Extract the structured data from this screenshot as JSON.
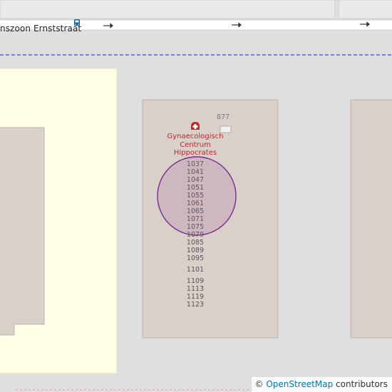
{
  "map": {
    "street_name": "nszoon Ernststraat",
    "poi": {
      "name_lines": [
        "Gynaecologisch",
        "Centrum",
        "Hippocrates"
      ],
      "icon": "medical-cross-icon",
      "color": "#c2262a"
    },
    "house_number_top": "877",
    "house_numbers": [
      "1037",
      "1041",
      "1047",
      "1051",
      "1055",
      "1061",
      "1065",
      "1071",
      "1075",
      "1079",
      "1085",
      "1089",
      "1095",
      "1101",
      "1109",
      "1113",
      "1119",
      "1123"
    ],
    "colors": {
      "background": "#e0dfdf",
      "building": "#d9d0c9",
      "building_outline": "#bcb3ab",
      "residential": "#ffffe5",
      "road": "#ffffff",
      "boundary": "#3b44c8",
      "highlight_circle": "#7b2a8c"
    }
  },
  "attribution": {
    "copyright": "©",
    "link_text": "OpenStreetMap",
    "suffix": " contributors"
  }
}
